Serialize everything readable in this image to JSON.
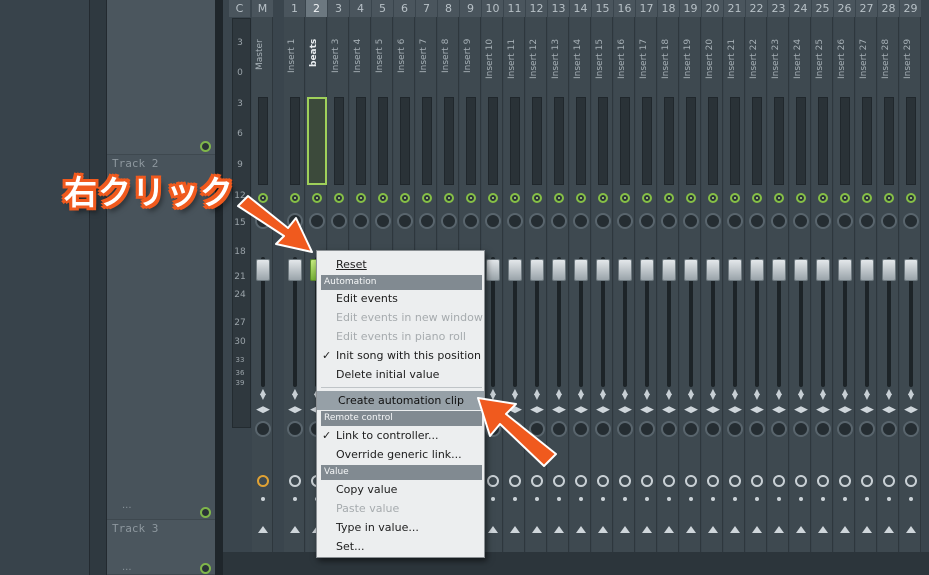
{
  "playlist": {
    "track2_label": "Track 2",
    "track3_label": "Track 3",
    "dots": "..."
  },
  "mixer": {
    "top_headers": [
      "C",
      "M"
    ],
    "db_scale": [
      "3",
      "0",
      "3",
      "6",
      "9",
      "12",
      "15",
      "18",
      "21",
      "24",
      "27",
      "30",
      "33",
      "36",
      "39"
    ],
    "strips": [
      {
        "num": "",
        "name": "Master"
      },
      {
        "num": "1",
        "name": "Insert 1"
      },
      {
        "num": "2",
        "name": "beats"
      },
      {
        "num": "3",
        "name": "Insert 3"
      },
      {
        "num": "4",
        "name": "Insert 4"
      },
      {
        "num": "5",
        "name": "Insert 5"
      },
      {
        "num": "6",
        "name": "Insert 6"
      },
      {
        "num": "7",
        "name": "Insert 7"
      },
      {
        "num": "8",
        "name": "Insert 8"
      },
      {
        "num": "9",
        "name": "Insert 9"
      },
      {
        "num": "10",
        "name": "Insert 10"
      },
      {
        "num": "11",
        "name": "Insert 11"
      },
      {
        "num": "12",
        "name": "Insert 12"
      },
      {
        "num": "13",
        "name": "Insert 13"
      },
      {
        "num": "14",
        "name": "Insert 14"
      },
      {
        "num": "15",
        "name": "Insert 15"
      },
      {
        "num": "16",
        "name": "Insert 16"
      },
      {
        "num": "17",
        "name": "Insert 17"
      },
      {
        "num": "18",
        "name": "Insert 18"
      },
      {
        "num": "19",
        "name": "Insert 19"
      },
      {
        "num": "20",
        "name": "Insert 20"
      },
      {
        "num": "21",
        "name": "Insert 21"
      },
      {
        "num": "22",
        "name": "Insert 22"
      },
      {
        "num": "23",
        "name": "Insert 23"
      },
      {
        "num": "24",
        "name": "Insert 24"
      },
      {
        "num": "25",
        "name": "Insert 25"
      },
      {
        "num": "26",
        "name": "Insert 26"
      },
      {
        "num": "27",
        "name": "Insert 27"
      },
      {
        "num": "28",
        "name": "Insert 28"
      },
      {
        "num": "29",
        "name": "Insert 29"
      }
    ],
    "selected_strip": "2"
  },
  "context_menu": {
    "reset": "Reset",
    "automation_header": "Automation",
    "edit_events": "Edit events",
    "edit_events_new_window": "Edit events in new window",
    "edit_events_piano_roll": "Edit events in piano roll",
    "init_song": "Init song with this position",
    "delete_initial": "Delete initial value",
    "create_automation_clip": "Create automation clip",
    "remote_control_header": "Remote control",
    "link_to_controller": "Link to controller...",
    "override_generic_link": "Override generic link...",
    "value_header": "Value",
    "copy_value": "Copy value",
    "paste_value": "Paste value",
    "type_in_value": "Type in value...",
    "set": "Set..."
  },
  "annotation": {
    "callout_text": "右クリック",
    "color": "#f05a1e"
  }
}
